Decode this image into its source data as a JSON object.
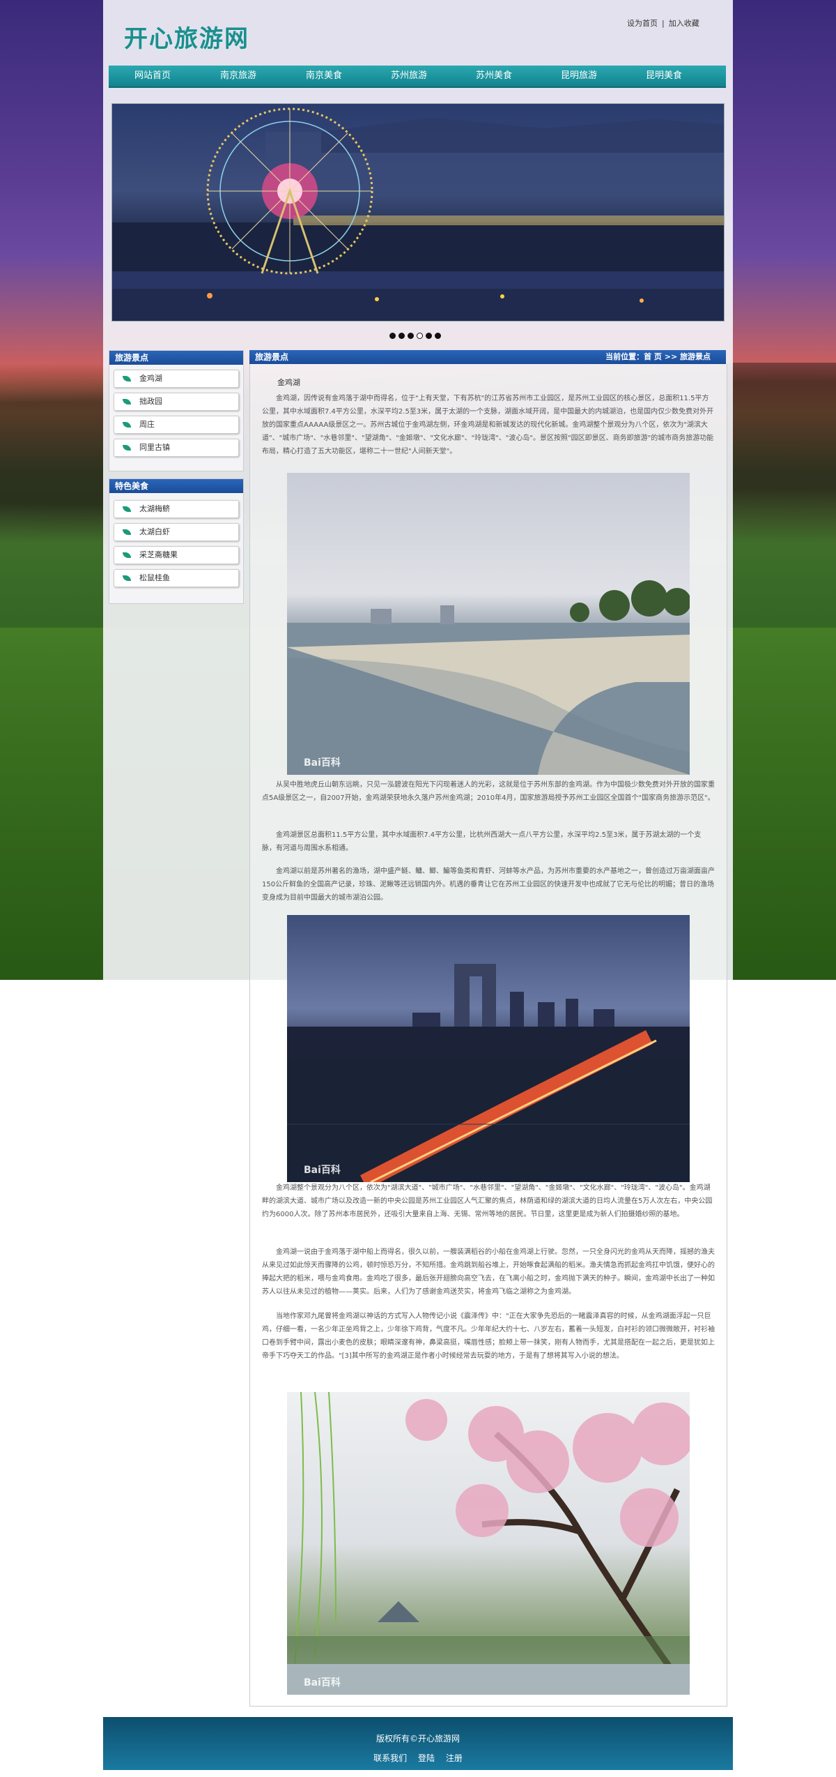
{
  "header": {
    "logo": "开心旅游网",
    "set_home": "设为首页",
    "separator": "|",
    "favorite": "加入收藏"
  },
  "nav": {
    "items": [
      "网站首页",
      "南京旅游",
      "南京美食",
      "苏州旅游",
      "苏州美食",
      "昆明旅游",
      "昆明美食"
    ]
  },
  "banner": {
    "icon": "ferris-wheel-night-scene"
  },
  "slider": {
    "dot_count": 6,
    "active_index": 4
  },
  "sidebar": {
    "spots_title": "旅游景点",
    "spots": [
      "金鸡湖",
      "拙政园",
      "周庄",
      "同里古镇"
    ],
    "food_title": "特色美食",
    "foods": [
      "太湖梅鲚",
      "太湖白虾",
      "采芝斋糖果",
      "松鼠桂鱼"
    ]
  },
  "content": {
    "head_title": "旅游景点",
    "breadcrumb": "当前位置：首 页 >> 旅游景点",
    "title": "金鸡湖",
    "p1": "金鸡湖，因传说有金鸡落于湖中而得名，位于\"上有天堂，下有苏杭\"的江苏省苏州市工业园区，是苏州工业园区的核心景区，总面积11.5平方公里，其中水域面积7.4平方公里，水深平均2.5至3米，属于太湖的一个支脉，湖面水域开阔，是中国最大的内城湖泊，也是国内仅少数免费对外开放的国家重点AAAAA级景区之一。苏州古城位于金鸡湖左侧，环金鸡湖是和新城发达的现代化新城。金鸡湖整个景观分为八个区，依次为\"湖滨大道\"、\"城市广场\"、\"水巷邻里\"、\"望湖角\"、\"金姬墩\"、\"文化水廊\"、\"玲珑湾\"、\"波心岛\"。景区按照\"园区即景区、商务即旅游\"的城市商务旅游功能布局，精心打造了五大功能区，堪称二十一世纪\"人间新天堂\"。",
    "p2": "从吴中胜地虎丘山朝东远眺，只见一泓碧波在阳光下闪现着迷人的光彩，这就是位于苏州东部的金鸡湖。作为中国极少数免费对外开放的国家重点5A级景区之一，自2007开始，金鸡湖荣获地永久落户苏州金鸡湖；2010年4月，国家旅游局授予苏州工业园区全国首个\"国家商务旅游示范区\"。",
    "p3": "金鸡湖景区总面积11.5平方公里，其中水域面积7.4平方公里，比杭州西湖大一点八平方公里，水深平均2.5至3米，属于苏湖太湖的一个支脉，有河道与周围水系相通。",
    "p4": "金鸡湖以前是苏州著名的渔场，湖中盛产鲢、鳙、鲫、鳊等鱼类和青虾、河蚌等水产品，为苏州市重要的水产基地之一，曾创造过万亩湖面亩产150公斤鲜鱼的全国高产记录，珍珠、泥鳅等还远销国内外。机遇的垂青让它在苏州工业园区的快速开发中也成就了它无与伦比的明媚；昔日的渔场变身成为目前中国最大的城市湖泊公园。",
    "p5": "金鸡湖整个景观分为八个区，依次为\"湖滨大道\"、\"城市广场\"、\"水巷邻里\"、\"望湖角\"、\"金姬墩\"、\"文化水廊\"、\"玲珑湾\"、\"波心岛\"。金鸡湖畔的湖滨大道、城市广场以及改造一新的中央公园是苏州工业园区人气汇聚的焦点，林荫道和绿的湖滨大道的日均人流量在5万人次左右，中央公园约为6000人次。除了苏州本市居民外，还吸引大量来自上海、无锡、常州等地的居民。节日里，这里更是成为新人们拍摄婚纱照的基地。",
    "p6": "金鸡湖一说由于金鸡落于湖中船上而得名，很久以前，一艘装满稻谷的小船在金鸡湖上行驶。忽然，一只全身闪光的金鸡从天而降，摇撼的渔夫从来见过如此惊天而骤降的公鸡，顿时惊恐万分，不知所措。金鸡跳到船谷堆上，开始啄食起满船的稻米。渔夫情急而抓起金鸡扛中饥饿，便好心的捧起大把的稻米，喂与金鸡食用。金鸡吃了很多，最后张开翅膀向高空飞去，在飞离小船之时，金鸡抛下满天的种子。瞬间，金鸡湖中长出了一种如苏人以往从未见过的植物——荚实。后来，人们为了感谢金鸡送芡实，将金鸡飞临之湖称之为金鸡湖。",
    "p7": "当地作家邓九尾曾将金鸡湖以神话的方式写入人物传记小说《震泽传》中：\"正在大家争先恐后的一睹震泽真容的时候，从金鸡湖面浮起一只巨鸡，仔细一看，一名少年正坐鸡背之上，少年徐下鸡背，气度不凡。少年年纪大约十七、八岁左右，蓄着一头短发，白衬衫的领口微微敞开，衬衫袖口卷到手臂中间，露出小麦色的皮肤；眼睛深邃有神，鼻梁高挺，嘴唇性感；脸颊上带一抹笑，刚有人物而手，尤其是搭配在一起之后，更是犹如上帝手下巧夺天工的作品。\"[3]其中所写的金鸡湖正是作者小时候经常去玩耍的地方，于是有了想将其写入小说的想法。",
    "photo1_watermark": "Bai百科",
    "photo2_watermark": "Bai百科",
    "photo3_watermark": "Bai百科"
  },
  "footer": {
    "copyright": "版权所有©开心旅游网",
    "links": [
      "联系我们",
      "登陆",
      "注册"
    ]
  },
  "colors": {
    "nav": "#1a95a0",
    "panel_head": "#2a66b8",
    "footer": "#0d4e6e"
  }
}
